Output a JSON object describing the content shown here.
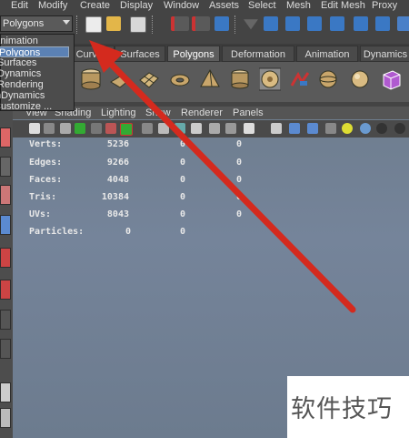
{
  "menubar": {
    "items": [
      "Edit",
      "Modify",
      "Create",
      "Display",
      "Window",
      "Assets",
      "Select",
      "Mesh",
      "Edit Mesh",
      "Proxy"
    ]
  },
  "menuset": {
    "value": "Polygons",
    "options": [
      "Animation",
      "Polygons",
      "Surfaces",
      "Dynamics",
      "Rendering",
      "nDynamics",
      "Customize ..."
    ],
    "selected_index": 1
  },
  "shelf": {
    "tabs": [
      "Curves",
      "Surfaces",
      "Polygons",
      "Deformation",
      "Animation",
      "Dynamics"
    ],
    "active_tab": "Polygons",
    "icons": [
      "cylinder-icon",
      "plane-icon",
      "torus-icon",
      "pyramid-icon",
      "pipe-icon",
      "soccer-ball-icon",
      "helix-icon",
      "combine-icon",
      "sphere-icon",
      "cube-icon"
    ]
  },
  "viewport": {
    "menu": [
      "View",
      "Shading",
      "Lighting",
      "Show",
      "Renderer",
      "Panels"
    ],
    "hud": {
      "rows": [
        {
          "label": "Verts:",
          "values": [
            "5236",
            "0",
            "0"
          ]
        },
        {
          "label": "Edges:",
          "values": [
            "9266",
            "0",
            "0"
          ]
        },
        {
          "label": "Faces:",
          "values": [
            "4048",
            "0",
            "0"
          ]
        },
        {
          "label": "Tris:",
          "values": [
            "10384",
            "0",
            "0"
          ]
        },
        {
          "label": "UVs:",
          "values": [
            "8043",
            "0",
            "0"
          ]
        },
        {
          "label": "Particles:",
          "values": [
            "0",
            "0"
          ]
        }
      ]
    }
  },
  "watermark": {
    "text": "软件技巧"
  },
  "colors": {
    "arrow": "#d42a1e",
    "selected_highlight": "#5b81b4",
    "viewport_bg": "#6e7d8e"
  }
}
